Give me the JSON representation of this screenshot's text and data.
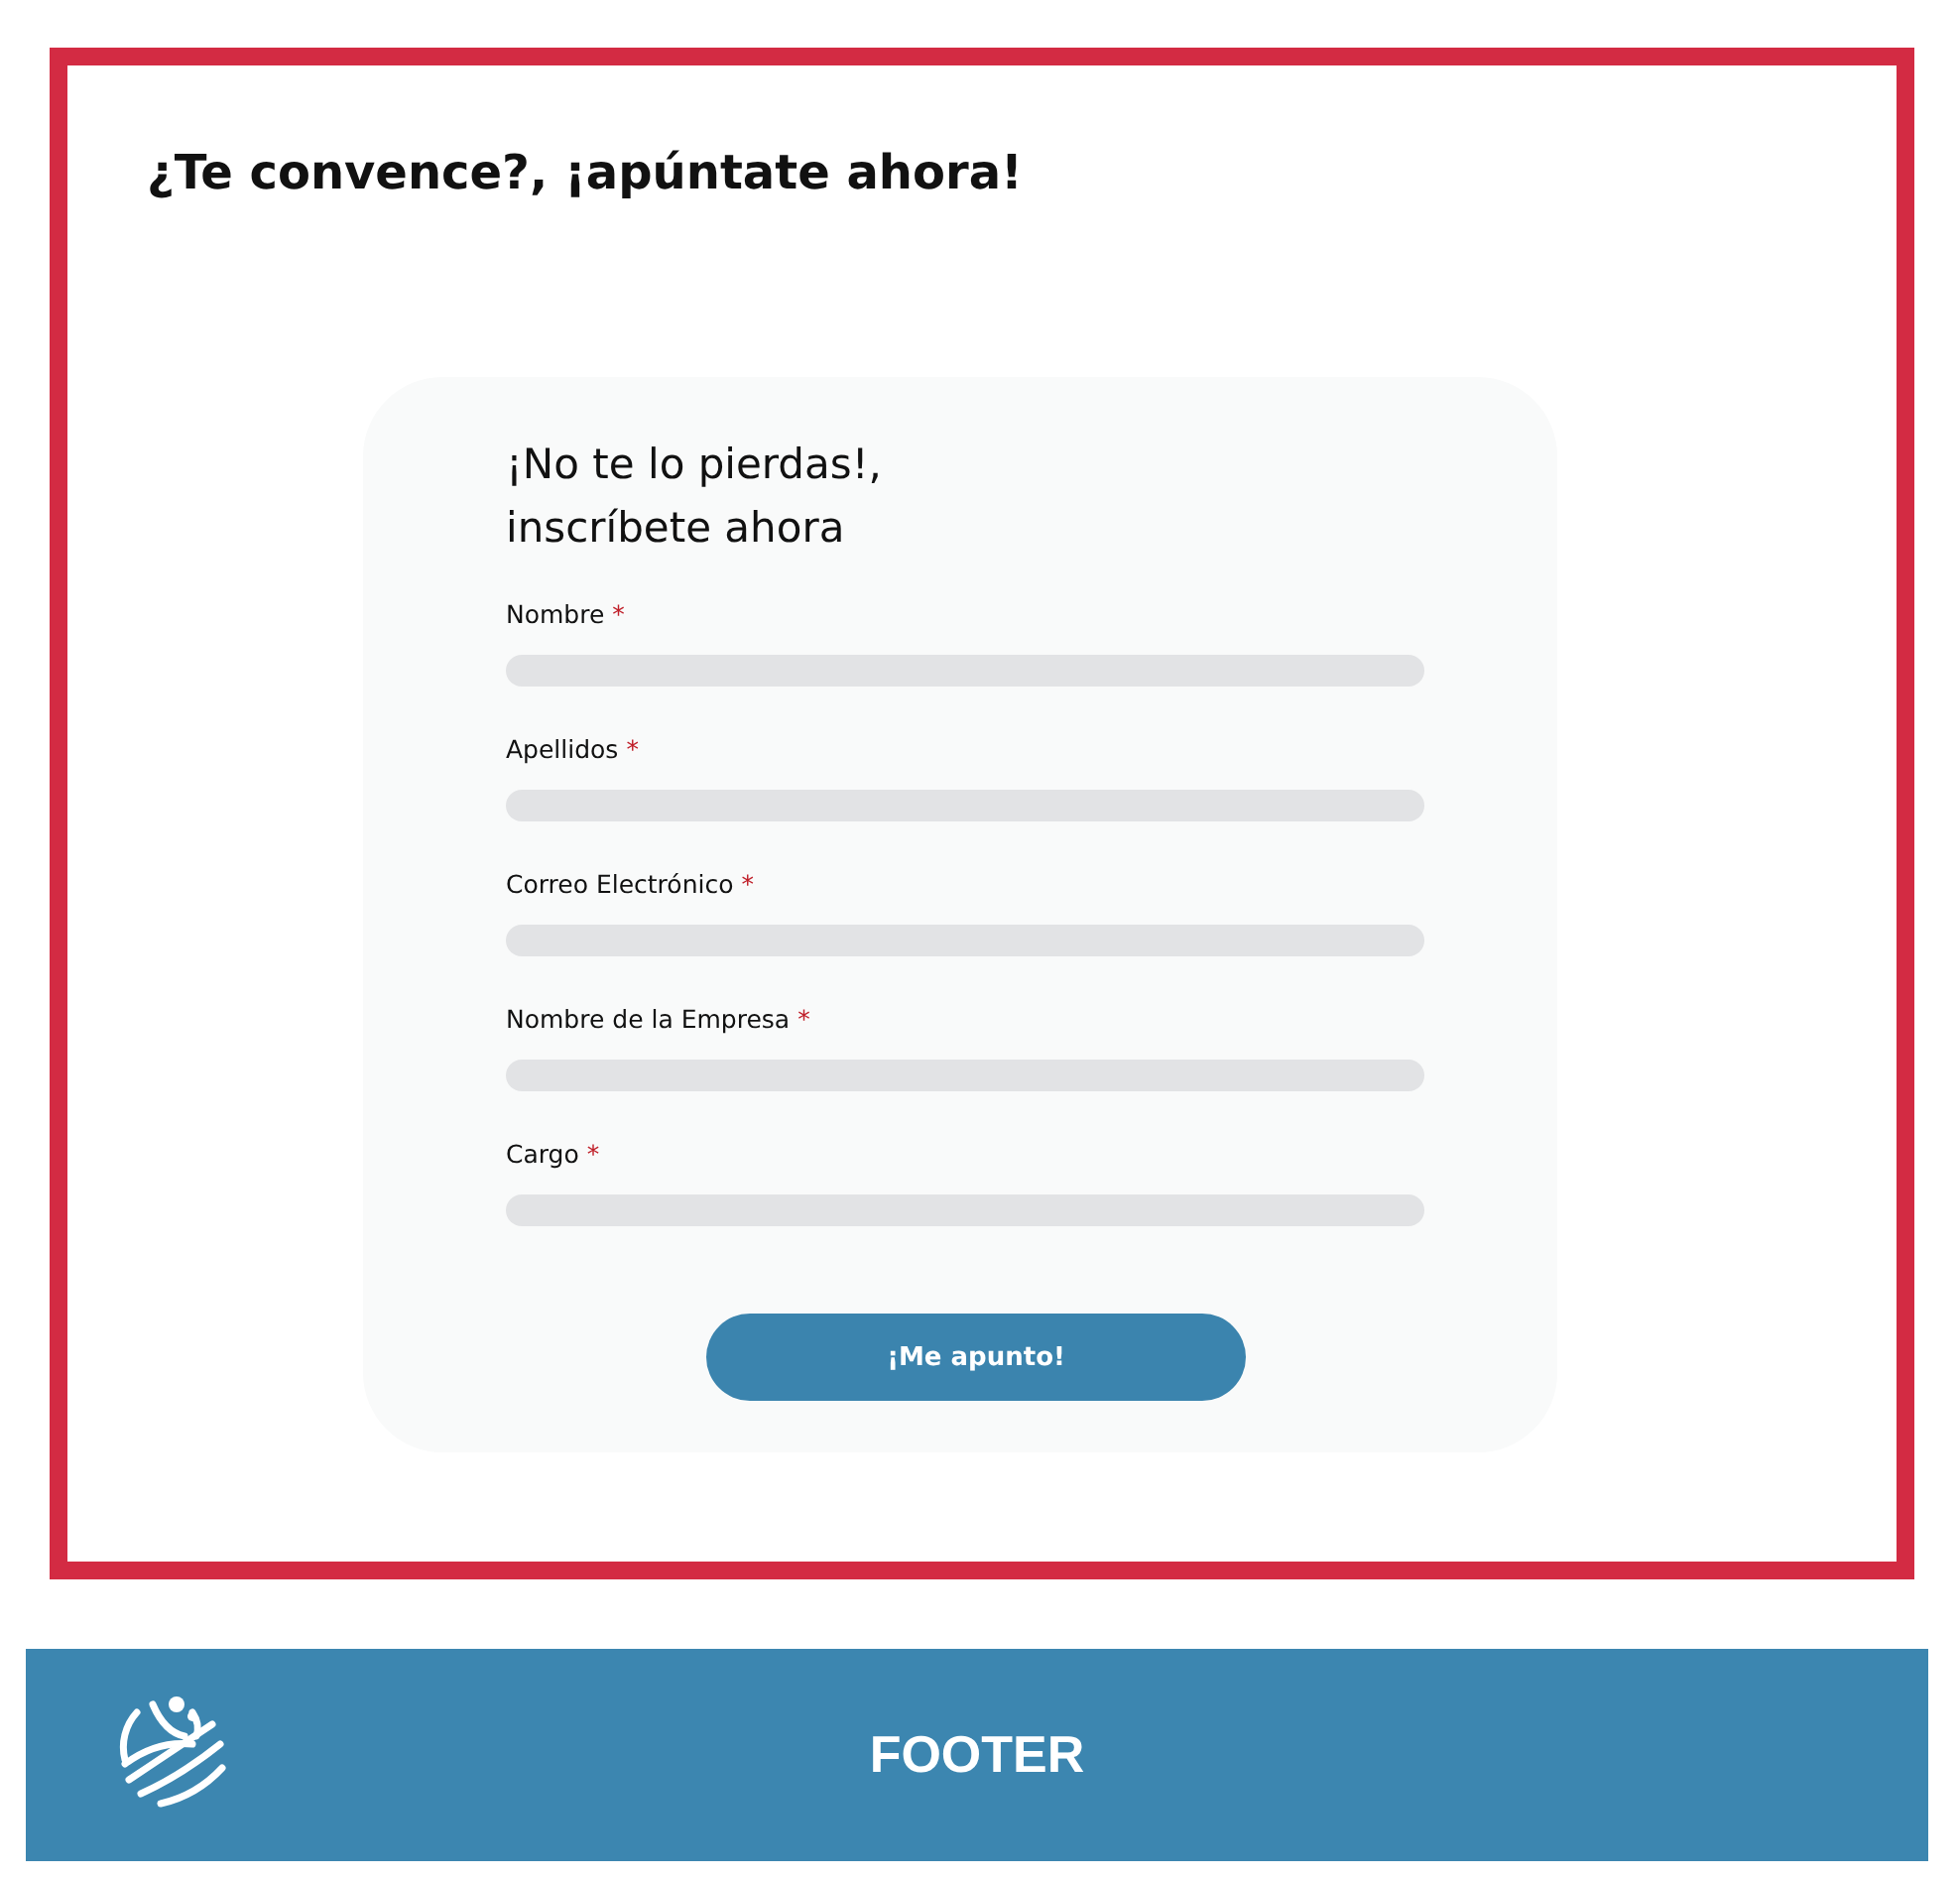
{
  "section": {
    "heading": "¿Te convence?, ¡apúntate ahora!"
  },
  "form": {
    "title": "¡No te lo pierdas!,\ninscríbete ahora",
    "fields": [
      {
        "label": "Nombre",
        "marker": "*"
      },
      {
        "label": "Apellidos",
        "marker": "*"
      },
      {
        "label": "Correo Electrónico",
        "marker": "*"
      },
      {
        "label": "Nombre de la Empresa",
        "marker": "*"
      },
      {
        "label": "Cargo",
        "marker": "*"
      }
    ],
    "submit": "¡Me apunto!"
  },
  "footer": {
    "text": "FOOTER"
  }
}
